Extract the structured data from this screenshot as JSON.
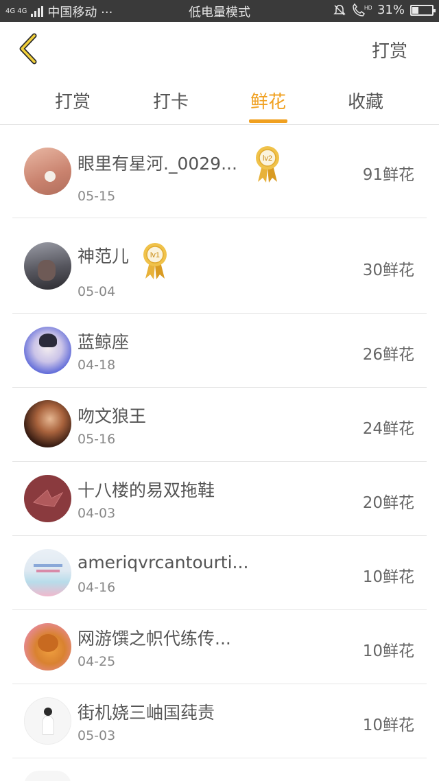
{
  "status_bar": {
    "network": "4G 4G",
    "carrier": "中国移动 ···",
    "mode": "低电量模式",
    "hd": "HD",
    "battery": "31%",
    "battery_level": 0.31
  },
  "header": {
    "action_label": "打赏"
  },
  "tabs": [
    {
      "label": "打赏",
      "active": false
    },
    {
      "label": "打卡",
      "active": false
    },
    {
      "label": "鲜花",
      "active": true
    },
    {
      "label": "收藏",
      "active": false
    }
  ],
  "rows": [
    {
      "name": "眼里有星河._0029...",
      "date": "05-15",
      "value": "91鲜花",
      "badge": "lv2"
    },
    {
      "name": "神范儿",
      "date": "05-04",
      "value": "30鲜花",
      "badge": "lv1"
    },
    {
      "name": "蓝鲸座",
      "date": "04-18",
      "value": "26鲜花"
    },
    {
      "name": "吻文狼王",
      "date": "05-16",
      "value": "24鲜花"
    },
    {
      "name": "十八楼的易双拖鞋",
      "date": "04-03",
      "value": "20鲜花"
    },
    {
      "name": "ameriqvrcantourti...",
      "date": "04-16",
      "value": "10鲜花"
    },
    {
      "name": "网游馔之帜代练传...",
      "date": "04-25",
      "value": "10鲜花"
    },
    {
      "name": "街机娆三岫国莼责",
      "date": "05-03",
      "value": "10鲜花"
    }
  ],
  "colors": {
    "accent": "#f0a020",
    "status_bar_bg": "#3a3a3a",
    "divider": "#e6e6e6"
  }
}
